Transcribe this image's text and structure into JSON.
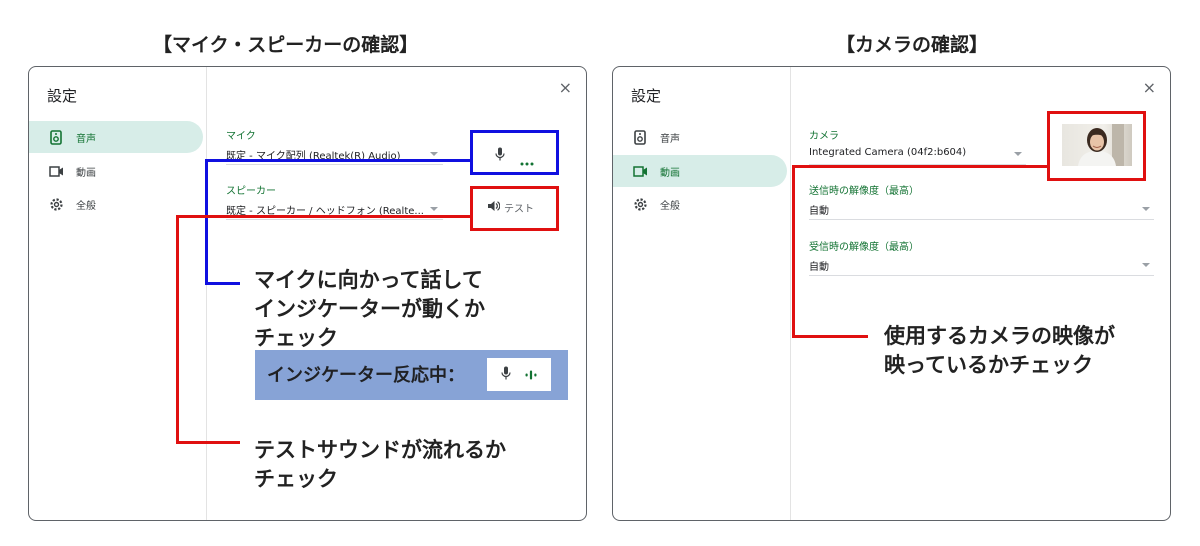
{
  "left": {
    "heading": "【マイク・スピーカーの確認】",
    "title": "設定",
    "close": "×",
    "nav": [
      {
        "label": "音声",
        "icon": "speaker-icon",
        "active": true
      },
      {
        "label": "動画",
        "icon": "video-icon",
        "active": false
      },
      {
        "label": "全般",
        "icon": "gear-icon",
        "active": false
      }
    ],
    "mic_label": "マイク",
    "mic_value": "既定 - マイク配列 (Realtek(R) Audio)",
    "speaker_label": "スピーカー",
    "speaker_value": "既定 - スピーカー / ヘッドフォン (Realte...",
    "test_button": "テスト",
    "mic_annotation": [
      "マイクに向かって話して",
      "インジケーターが動くか",
      "チェック"
    ],
    "live_banner": "インジケーター反応中：",
    "speaker_annotation": [
      "テストサウンドが流れるか",
      "チェック"
    ]
  },
  "right": {
    "heading": "【カメラの確認】",
    "title": "設定",
    "close": "×",
    "nav": [
      {
        "label": "音声",
        "icon": "speaker-icon",
        "active": false
      },
      {
        "label": "動画",
        "icon": "video-icon",
        "active": true
      },
      {
        "label": "全般",
        "icon": "gear-icon",
        "active": false
      }
    ],
    "camera_label": "カメラ",
    "camera_value": "Integrated Camera (04f2:b604)",
    "send_res_label": "送信時の解像度（最高）",
    "send_res_value": "自動",
    "recv_res_label": "受信時の解像度（最高）",
    "recv_res_value": "自動",
    "camera_annotation": [
      "使用するカメラの映像が",
      "映っているかチェック"
    ]
  },
  "colors": {
    "accent_green": "#137333",
    "active_nav_bg": "#d7ede8",
    "highlight_blue": "#1010e0",
    "highlight_red": "#e01010",
    "banner_bg": "#87a3d6"
  }
}
